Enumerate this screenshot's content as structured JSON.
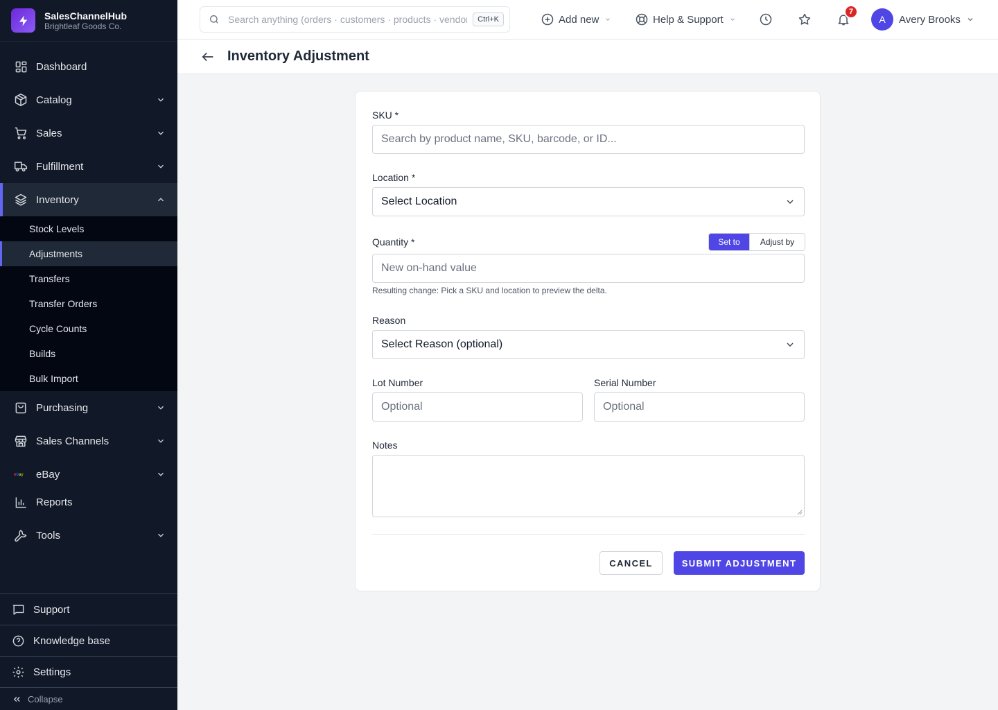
{
  "app": {
    "name": "SalesChannelHub",
    "company": "Brightleaf Goods Co."
  },
  "sidebar": {
    "items": [
      {
        "label": "Dashboard",
        "icon": "dashboard-icon"
      },
      {
        "label": "Catalog",
        "icon": "box-icon",
        "expandable": true
      },
      {
        "label": "Sales",
        "icon": "cart-icon",
        "expandable": true
      },
      {
        "label": "Fulfillment",
        "icon": "truck-icon",
        "expandable": true
      },
      {
        "label": "Inventory",
        "icon": "layers-icon",
        "expandable": true,
        "expanded": true
      },
      {
        "label": "Purchasing",
        "icon": "bag-icon",
        "expandable": true
      },
      {
        "label": "Sales Channels",
        "icon": "store-icon",
        "expandable": true
      },
      {
        "label": "eBay",
        "icon": "ebay-logo-icon",
        "expandable": true
      },
      {
        "label": "Reports",
        "icon": "bar-chart-icon"
      },
      {
        "label": "Tools",
        "icon": "wrench-icon",
        "expandable": true
      }
    ],
    "inventory_sub": [
      {
        "label": "Stock Levels"
      },
      {
        "label": "Adjustments",
        "active": true
      },
      {
        "label": "Transfers"
      },
      {
        "label": "Transfer Orders"
      },
      {
        "label": "Cycle Counts"
      },
      {
        "label": "Builds"
      },
      {
        "label": "Bulk Import"
      }
    ],
    "bottom": {
      "support": "Support",
      "knowledge_base": "Knowledge base",
      "settings": "Settings",
      "collapse": "Collapse"
    }
  },
  "topbar": {
    "search_placeholder": "Search anything (orders · customers · products · vendors)",
    "search_shortcut": "Ctrl+K",
    "add_new": "Add new",
    "help": "Help & Support",
    "notification_count": "7",
    "user_initial": "A",
    "user_name": "Avery Brooks"
  },
  "page": {
    "title": "Inventory Adjustment"
  },
  "form": {
    "sku_label": "SKU *",
    "sku_placeholder": "Search by product name, SKU, barcode, or ID...",
    "location_label": "Location *",
    "location_value": "Select Location",
    "quantity_label": "Quantity *",
    "mode_set": "Set to",
    "mode_adjust": "Adjust by",
    "quantity_placeholder": "New on-hand value",
    "quantity_helper": "Resulting change: Pick a SKU and location to preview the delta.",
    "reason_label": "Reason",
    "reason_value": "Select Reason (optional)",
    "lot_label": "Lot Number",
    "lot_placeholder": "Optional",
    "serial_label": "Serial Number",
    "serial_placeholder": "Optional",
    "notes_label": "Notes",
    "notes_value": "",
    "cancel": "CANCEL",
    "submit": "SUBMIT ADJUSTMENT"
  },
  "colors": {
    "sidebar_bg": "#111827",
    "accent": "#4f46e5",
    "badge": "#dc2626"
  }
}
